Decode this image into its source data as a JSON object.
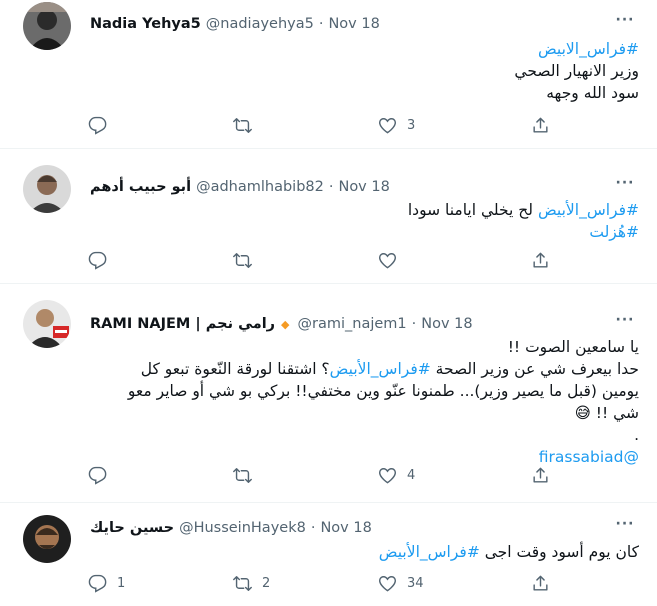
{
  "tweets": [
    {
      "name": "Nadia Yehya5",
      "handle": "@nadiayehya5",
      "date": "Nov 18",
      "lines": [
        "#فراس_الابيض",
        "وزير الانهيار الصحي",
        "سود الله وجهه"
      ],
      "counts": {
        "reply": "",
        "retweet": "",
        "like": "3"
      }
    },
    {
      "name": "أبو حبيب أدهم",
      "handle": "@adhamlhabib82",
      "date": "Nov 18",
      "line1_hashtag": "#فراس_الأبيض",
      "line1_text": "لح يخلي ايامنا سودا",
      "line2_hashtag": "#هُزلت",
      "counts": {
        "reply": "",
        "retweet": "",
        "like": ""
      }
    },
    {
      "name": "RAMI NAJEM | رامي نجم",
      "handle": "@rami_najem1",
      "date": "Nov 18",
      "line1": "يا سامعين الصوت !!",
      "line2_pre": "حدا بيعرف شي عن وزير الصحة",
      "line2_hashtag": "#فراس_الأبيض",
      "line2_post": "؟ اشتقنا لورقة النّعوة تبعو كل",
      "line3": "يومين (قبل ما يصير وزير)... طمنونا عنّو وين مختفي!! بركي بو شي أو صاير معو",
      "line4": "شي !! 😅",
      "line5": ".",
      "mention": "@firassabiad",
      "counts": {
        "reply": "",
        "retweet": "",
        "like": "4"
      }
    },
    {
      "name": "حسين حايك",
      "handle": "@HusseinHayek8",
      "date": "Nov 18",
      "text": "كان يوم أسود وقت اجى",
      "hashtag": "#فراس_الأبيض",
      "counts": {
        "reply": "1",
        "retweet": "2",
        "like": "34"
      }
    }
  ],
  "separator": "·",
  "colors": {
    "accent": "#1d9bf0",
    "muted": "#536471",
    "verified": "#f59b24"
  }
}
